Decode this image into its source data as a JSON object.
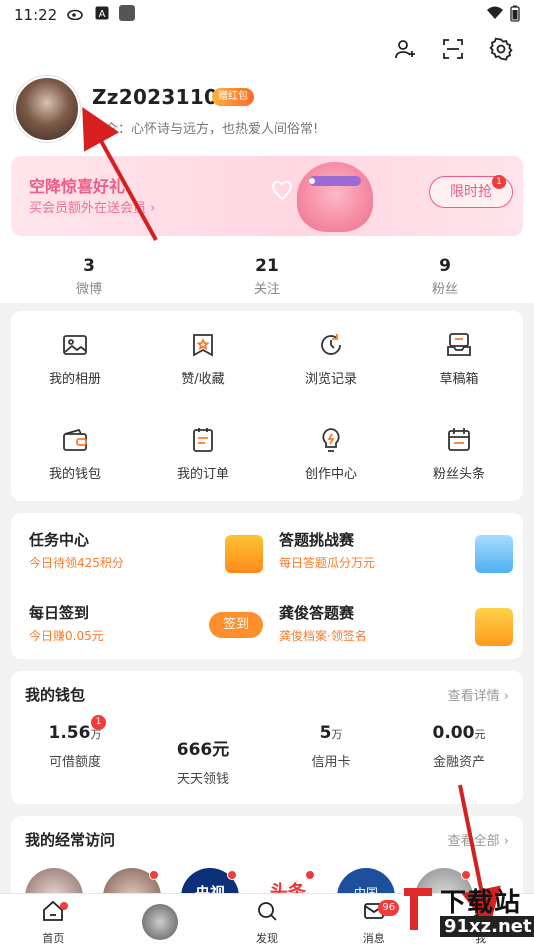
{
  "status_bar": {
    "time": "11:22",
    "icons": [
      "weibo-icon",
      "a-icon",
      "square-icon"
    ],
    "right_icons": [
      "wifi-icon",
      "battery-icon"
    ]
  },
  "top_actions": [
    "add-friend-icon",
    "scan-icon",
    "settings-icon"
  ],
  "profile": {
    "username": "Zz20231103",
    "vip_badge": "赠红包",
    "bio": "简介：心怀诗与远方，也热爱人间俗常!"
  },
  "banner": {
    "title": "空降惊喜好礼",
    "subtitle": "买会员额外在送会员 ›",
    "button": "限时抢",
    "badge": "1"
  },
  "stats": [
    {
      "value": "3",
      "label": "微博"
    },
    {
      "value": "21",
      "label": "关注"
    },
    {
      "value": "9",
      "label": "粉丝"
    }
  ],
  "grid": [
    {
      "label": "我的相册",
      "icon": "photo-icon"
    },
    {
      "label": "赞/收藏",
      "icon": "favorite-icon"
    },
    {
      "label": "浏览记录",
      "icon": "history-icon"
    },
    {
      "label": "草稿箱",
      "icon": "drafts-icon"
    },
    {
      "label": "我的钱包",
      "icon": "wallet-icon"
    },
    {
      "label": "我的订单",
      "icon": "order-icon"
    },
    {
      "label": "创作中心",
      "icon": "bulb-icon"
    },
    {
      "label": "粉丝头条",
      "icon": "calendar-icon"
    }
  ],
  "tasks": [
    {
      "title": "任务中心",
      "sub": "今日待领425积分"
    },
    {
      "title": "答题挑战赛",
      "sub": "每日答题瓜分万元"
    },
    {
      "title": "每日签到",
      "sub": "今日赚0.05元",
      "button": "签到"
    },
    {
      "title": "龚俊答题赛",
      "sub": "龚俊档案·领签名"
    }
  ],
  "wallet": {
    "title": "我的钱包",
    "more": "查看详情 ›",
    "items": [
      {
        "value": "1.56",
        "unit": "万",
        "label": "可借额度",
        "badge": "1"
      },
      {
        "value": "666元",
        "unit": "",
        "label": "天天领钱"
      },
      {
        "value": "5",
        "unit": "万",
        "label": "信用卡"
      },
      {
        "value": "0.00",
        "unit": "元",
        "label": "金融资产"
      }
    ]
  },
  "visits": {
    "title": "我的经常访问",
    "more": "查看全部 ›",
    "items": [
      "央视",
      "头条",
      "中国"
    ]
  },
  "tabbar": [
    {
      "label": "首页",
      "icon": "home-icon"
    },
    {
      "label": "",
      "icon": "center-avatar-icon"
    },
    {
      "label": "发现",
      "icon": "search-icon"
    },
    {
      "label": "消息",
      "icon": "message-icon",
      "count": "96"
    },
    {
      "label": "我",
      "icon": "profile-icon"
    }
  ],
  "watermark": {
    "text": "下载站",
    "url": "91xz.net"
  },
  "colors": {
    "accent": "#ff7a28",
    "pink": "#ef5a86",
    "red": "#f23b3b",
    "arrow": "#d61f1f"
  }
}
